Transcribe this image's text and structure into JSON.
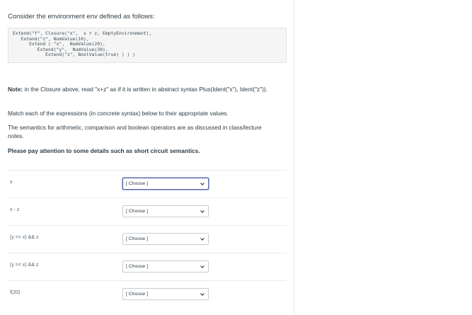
{
  "question": {
    "intro": "Consider the environment env defined as follows:",
    "code_lines": [
      "Extend(\"f\", Closure(\"x\",  x + z, EmptyEnvironment),",
      "   Extend(\"z\", NumValue(10),",
      "      Extend ( \"x\",  NumValue(20),",
      "         Extend(\"y\",  NumValue(30),",
      "            Extend(\"z\", BoolValue(true) ) ) )"
    ],
    "note_label": "Note:",
    "note_text": " in the Closure above, read \"x+z\" as if it is written in abstract syntax Plus(Ident(\"x\"), Ident(\"z\")).",
    "match_text": "Match each of the expressions (in concrete syntax) below to their appropriate values.",
    "semantics_text": "The semantics for arithmetic, comparison  and boolean operators are as discussed in class/lecture notes.",
    "attention_text": "Please pay attention to some details such as short circuit semantics."
  },
  "rows": [
    {
      "expression": "x",
      "selected": "[ Choose ]"
    },
    {
      "expression": "x - z",
      "selected": "[ Choose ]"
    },
    {
      "expression": "(y <= x) && z",
      "selected": "[ Choose ]"
    },
    {
      "expression": "(y >= x) && z",
      "selected": "[ Choose ]"
    },
    {
      "expression": "f(20)",
      "selected": "[ Choose ]"
    }
  ],
  "icons": {
    "dropdown": "chevron-down-icon"
  }
}
